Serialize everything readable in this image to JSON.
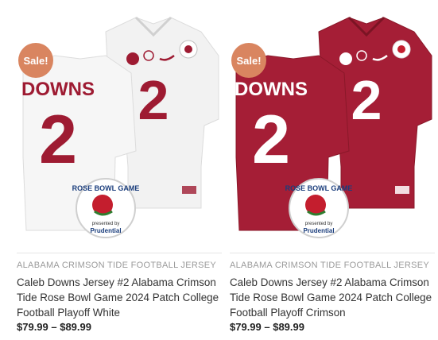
{
  "products": [
    {
      "sale_badge": "Sale!",
      "category": "ALABAMA CRIMSON TIDE FOOTBALL JERSEY",
      "title": "Caleb Downs Jersey #2 Alabama Crimson Tide Rose Bowl Game 2024 Patch College Football Playoff White",
      "price": "$79.99 – $89.99",
      "jersey_name": "DOWNS",
      "jersey_number": "2",
      "patch_text_top": "ROSE BOWL GAME",
      "patch_text_sub": "presented by",
      "patch_sponsor": "Prudential",
      "colors": {
        "body": "#f4f4f4",
        "accent": "#9e1b32",
        "number_trim": "#9e1b32"
      }
    },
    {
      "sale_badge": "Sale!",
      "category": "ALABAMA CRIMSON TIDE FOOTBALL JERSEY",
      "title": "Caleb Downs Jersey #2 Alabama Crimson Tide Rose Bowl Game 2024 Patch College Football Playoff Crimson",
      "price": "$79.99 – $89.99",
      "jersey_name": "DOWNS",
      "jersey_number": "2",
      "patch_text_top": "ROSE BOWL GAME",
      "patch_text_sub": "presented by",
      "patch_sponsor": "Prudential",
      "colors": {
        "body": "#a51e36",
        "accent": "#ffffff",
        "number_trim": "#ffffff"
      }
    }
  ]
}
